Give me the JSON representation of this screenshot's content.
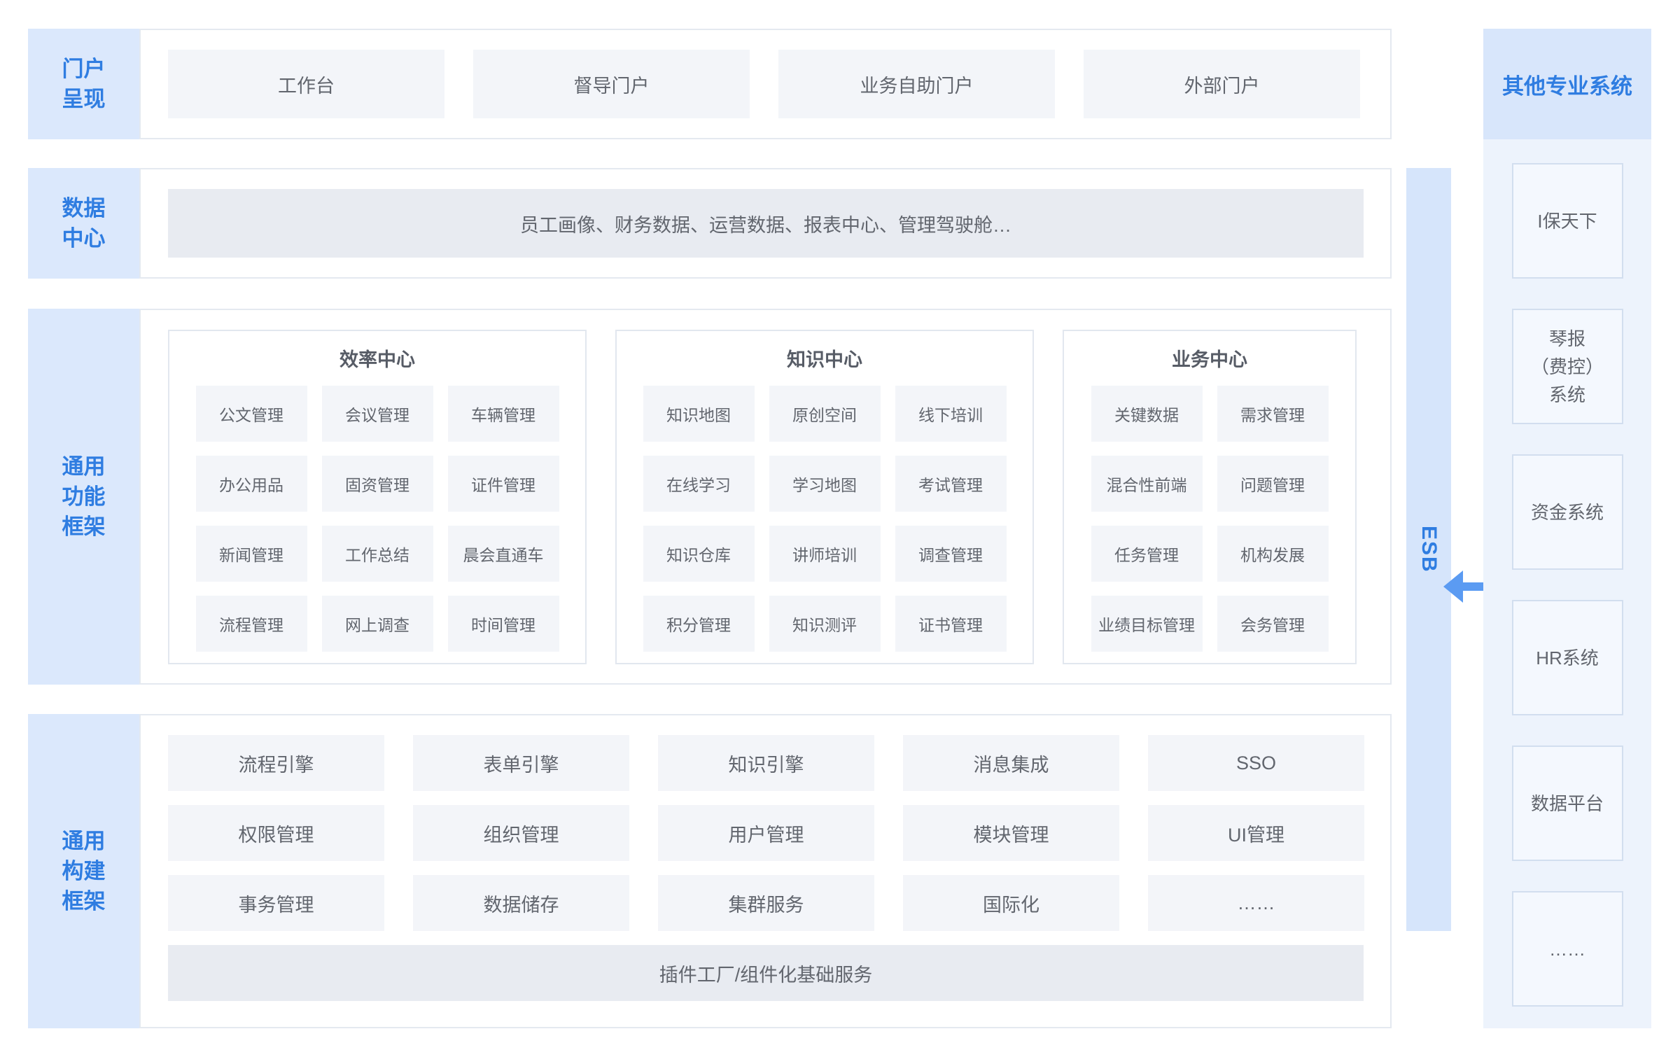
{
  "portal_row": {
    "label": "门户\n呈现",
    "items": [
      "工作台",
      "督导门户",
      "业务自助门户",
      "外部门户"
    ]
  },
  "data_row": {
    "label": "数据\n中心",
    "summary": "员工画像、财务数据、运营数据、报表中心、管理驾驶舱…"
  },
  "function_row": {
    "label": "通用\n功能\n框架",
    "panels": [
      {
        "title": "效率中心",
        "items": [
          "公文管理",
          "会议管理",
          "车辆管理",
          "办公用品",
          "固资管理",
          "证件管理",
          "新闻管理",
          "工作总结",
          "晨会直通车",
          "流程管理",
          "网上调查",
          "时间管理"
        ]
      },
      {
        "title": "知识中心",
        "items": [
          "知识地图",
          "原创空间",
          "线下培训",
          "在线学习",
          "学习地图",
          "考试管理",
          "知识仓库",
          "讲师培训",
          "调查管理",
          "积分管理",
          "知识测评",
          "证书管理"
        ]
      },
      {
        "title": "业务中心",
        "items": [
          "关键数据",
          "需求管理",
          "混合性前端",
          "问题管理",
          "任务管理",
          "机构发展",
          "业绩目标管理",
          "会务管理"
        ]
      }
    ]
  },
  "build_row": {
    "label": "通用\n构建\n框架",
    "items": [
      "流程引擎",
      "表单引擎",
      "知识引擎",
      "消息集成",
      "SSO",
      "权限管理",
      "组织管理",
      "用户管理",
      "模块管理",
      "UI管理",
      "事务管理",
      "数据储存",
      "集群服务",
      "国际化",
      "……"
    ],
    "base_service": "插件工厂/组件化基础服务"
  },
  "esb": {
    "label": "ESB",
    "link_icon": "double-arrow-icon"
  },
  "other_systems": {
    "title": "其他专业系统",
    "items": [
      "I保天下",
      "琴报\n（费控）\n系统",
      "资金系统",
      "HR系统",
      "数据平台",
      "……"
    ]
  },
  "colors": {
    "accent": "#2f7de1",
    "label_bg": "#dbe8fc",
    "frame_border": "#e4e9f0",
    "panel_border": "#e2e7ef",
    "cell_bg": "#f3f5f9",
    "bar_bg": "#e8ebf1",
    "text": "#62666e",
    "title_text": "#575c66",
    "esb_bg": "#d6e5fb",
    "arrow": "#5b9bf2",
    "side_bg": "#edf3fc",
    "side_header_bg": "#d8e6fb",
    "side_item_bg": "#f4f8fe",
    "side_item_border": "#d2deef"
  }
}
